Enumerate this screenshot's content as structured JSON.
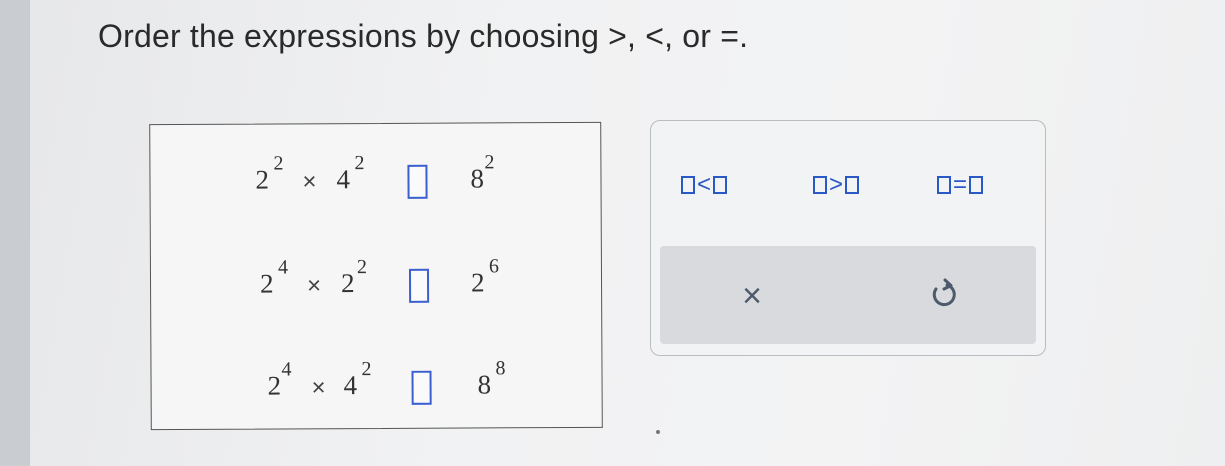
{
  "instruction": "Order the expressions by choosing >, <, or =.",
  "rows": [
    {
      "left_base1": "2",
      "left_exp1": "2",
      "times": "×",
      "left_base2": "4",
      "left_exp2": "2",
      "right_base": "8",
      "right_exp": "2"
    },
    {
      "left_base1": "2",
      "left_exp1": "4",
      "times": "×",
      "left_base2": "2",
      "left_exp2": "2",
      "right_base": "2",
      "right_exp": "6"
    },
    {
      "left_base1": "2",
      "left_exp1": "4",
      "times": "×",
      "left_base2": "4",
      "left_exp2": "2",
      "right_base": "8",
      "right_exp": "8"
    }
  ],
  "palette": {
    "less_than": "<",
    "greater_than": ">",
    "equals": "=",
    "clear_symbol": "×",
    "clear_icon": "close-icon",
    "undo_icon": "undo-icon"
  },
  "colors": {
    "accent_blue": "#2a58c6",
    "action_bar": "#d8dadd",
    "icon_gray": "#4c5a6c"
  }
}
